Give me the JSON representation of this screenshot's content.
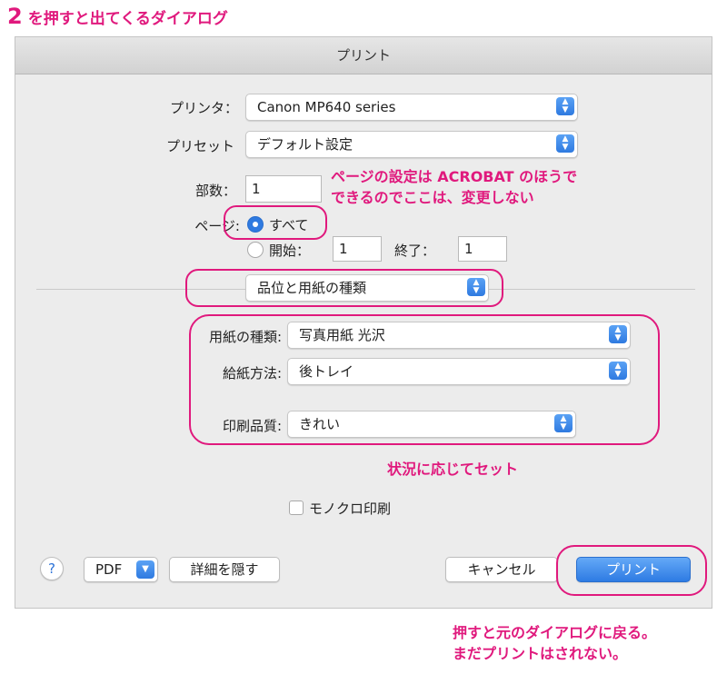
{
  "heading": {
    "number": "2",
    "text": "を押すと出てくるダイアログ"
  },
  "dialog": {
    "title": "プリント"
  },
  "printer": {
    "label": "プリンタ：",
    "value": "Canon MP640 series"
  },
  "preset": {
    "label": "プリセット",
    "value": "デフォルト設定"
  },
  "copies": {
    "label": "部数：",
    "value": "1"
  },
  "pages": {
    "label": "ページ:",
    "all_label": "すべて",
    "all_selected": true,
    "from_label": "開始：",
    "from_value": "1",
    "to_label": "終了：",
    "to_value": "1"
  },
  "section": {
    "value": "品位と用紙の種類"
  },
  "paper_type": {
    "label": "用紙の種類:",
    "value": "写真用紙 光沢"
  },
  "paper_source": {
    "label": "給紙方法:",
    "value": "後トレイ"
  },
  "print_quality": {
    "label": "印刷品質:",
    "value": "きれい"
  },
  "monochrome": {
    "label": "モノクロ印刷",
    "checked": false
  },
  "buttons": {
    "help": "?",
    "pdf": "PDF",
    "hide_details": "詳細を隠す",
    "cancel": "キャンセル",
    "print": "プリント"
  },
  "annotations": {
    "pages_note_line1": "ページの設定は ACROBAT のほうで",
    "pages_note_line2": "できるのでここは、変更しない",
    "settings_note": "状況に応じてセット",
    "print_note_line1": "押すと元のダイアログに戻る。",
    "print_note_line2": "まだプリントはされない。"
  },
  "colors": {
    "accent": "#e0197d",
    "control_blue": "#2f7ae0"
  }
}
